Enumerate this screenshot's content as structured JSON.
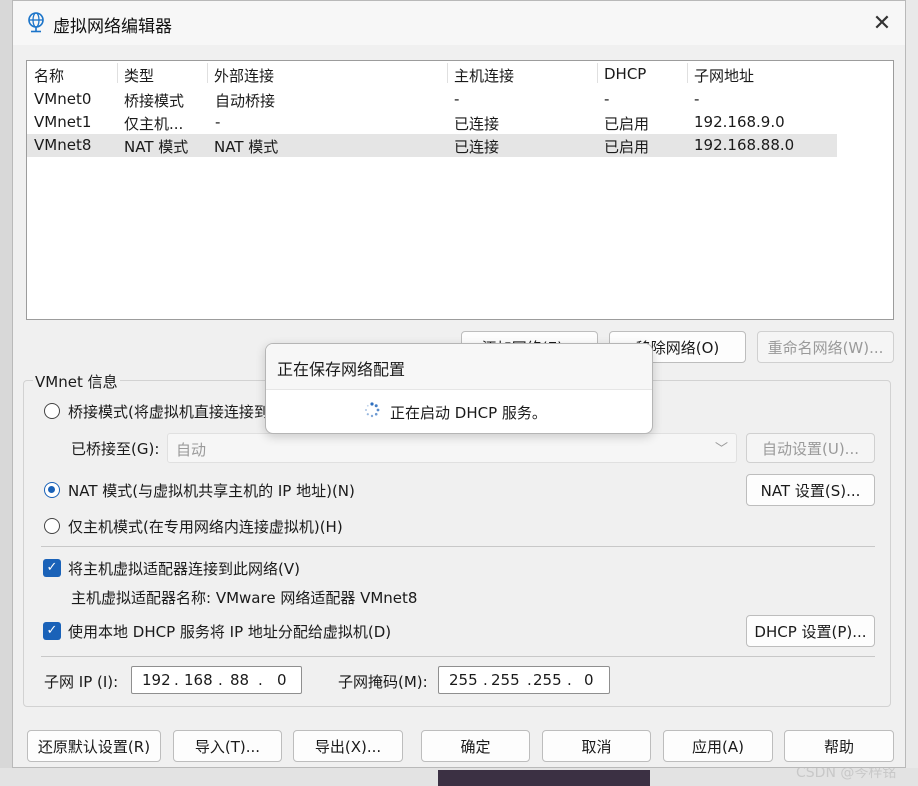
{
  "window": {
    "title": "虚拟网络编辑器",
    "app_icon": "globe-network-icon",
    "close_icon": "close-icon"
  },
  "table": {
    "headers": [
      "名称",
      "类型",
      "外部连接",
      "主机连接",
      "DHCP",
      "子网地址"
    ],
    "rows": [
      [
        "VMnet0",
        "桥接模式",
        "自动桥接",
        "-",
        "-",
        "-"
      ],
      [
        "VMnet1",
        "仅主机...",
        "-",
        "已连接",
        "已启用",
        "192.168.9.0"
      ],
      [
        "VMnet8",
        "NAT 模式",
        "NAT 模式",
        "已连接",
        "已启用",
        "192.168.88.0"
      ]
    ],
    "selected_row": 2
  },
  "list_buttons": {
    "add_network": "添加网络(E)...",
    "remove_network": "移除网络(O)",
    "rename_network": "重命名网络(W)..."
  },
  "vmnet_info": {
    "group_title": "VMnet 信息",
    "bridged_radio": "桥接模式(将虚拟机直接连接到外部网络)(B)",
    "bridged_to_label": "已桥接至(G):",
    "bridged_to_value": "自动",
    "auto_settings": "自动设置(U)...",
    "nat_radio": "NAT 模式(与虚拟机共享主机的 IP 地址)(N)",
    "nat_settings": "NAT 设置(S)...",
    "hostonly_radio": "仅主机模式(在专用网络内连接虚拟机)(H)",
    "connect_adapter_check": "将主机虚拟适配器连接到此网络(V)",
    "adapter_name": "主机虚拟适配器名称: VMware 网络适配器 VMnet8",
    "dhcp_check": "使用本地 DHCP 服务将 IP 地址分配给虚拟机(D)",
    "dhcp_settings": "DHCP 设置(P)...",
    "subnet_ip_label": "子网 IP (I):",
    "subnet_ip": [
      "192",
      "168",
      "88",
      "0"
    ],
    "subnet_mask_label": "子网掩码(M):",
    "subnet_mask": [
      "255",
      "255",
      "255",
      "0"
    ]
  },
  "footer_buttons": {
    "restore_defaults": "还原默认设置(R)",
    "import": "导入(T)...",
    "export": "导出(X)...",
    "ok": "确定",
    "cancel": "取消",
    "apply": "应用(A)",
    "help": "帮助"
  },
  "progress_dialog": {
    "title": "正在保存网络配置",
    "message": "正在启动 DHCP 服务。",
    "icon": "spinner-icon"
  },
  "background": {
    "watermark": "CSDN @岑梓铭"
  },
  "colors": {
    "accent": "#1a62b8",
    "selected_row": "#e5e5e5",
    "window_bg": "#f0f0f0"
  }
}
